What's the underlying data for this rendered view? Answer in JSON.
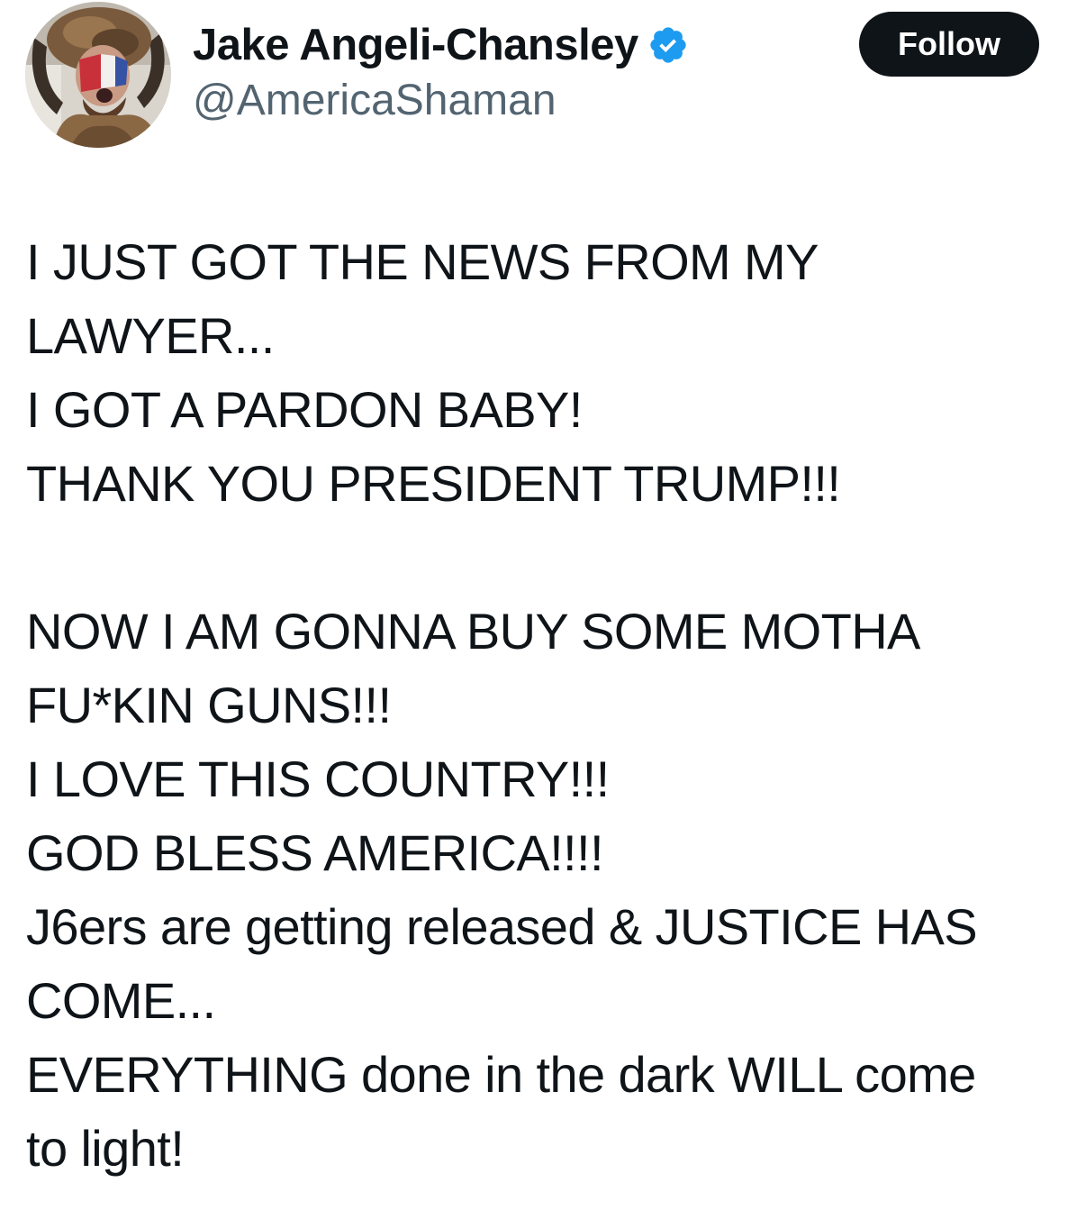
{
  "author": {
    "display_name": "Jake Angeli-Chansley",
    "handle": "@AmericaShaman",
    "verified": true,
    "verified_color": "#1d9bf0"
  },
  "actions": {
    "follow_label": "Follow"
  },
  "tweet": {
    "paragraph_1": [
      "I JUST GOT THE NEWS FROM MY",
      "LAWYER...",
      "I GOT A PARDON BABY!",
      "THANK YOU PRESIDENT TRUMP!!!"
    ],
    "paragraph_2": [
      "NOW I AM GONNA BUY SOME MOTHA",
      "FU*KIN GUNS!!!",
      "I LOVE THIS COUNTRY!!!",
      "GOD BLESS AMERICA!!!!",
      "J6ers are getting released & JUSTICE HAS",
      "COME...",
      "EVERYTHING done in the dark WILL come",
      "to light!"
    ]
  },
  "icons": {
    "avatar": "profile-photo",
    "badge": "verified-badge-icon"
  }
}
